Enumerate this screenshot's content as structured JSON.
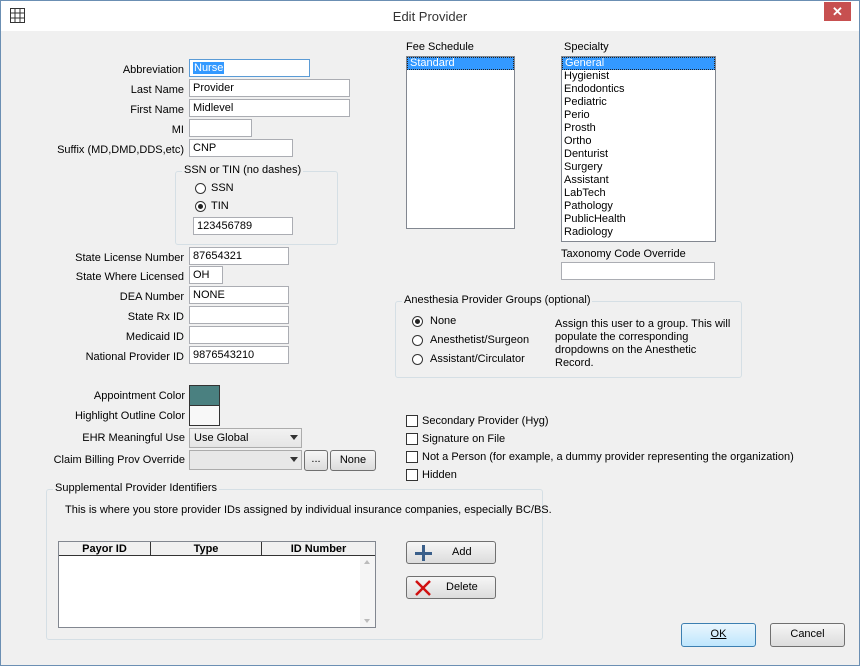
{
  "window": {
    "title": "Edit Provider"
  },
  "fields": {
    "abbreviation": {
      "label": "Abbreviation",
      "value": "Nurse"
    },
    "last_name": {
      "label": "Last Name",
      "value": "Provider"
    },
    "first_name": {
      "label": "First Name",
      "value": "Midlevel"
    },
    "mi": {
      "label": "MI",
      "value": ""
    },
    "suffix": {
      "label": "Suffix (MD,DMD,DDS,etc)",
      "value": "CNP"
    },
    "state_license": {
      "label": "State License Number",
      "value": "87654321"
    },
    "state_where_licensed": {
      "label": "State Where Licensed",
      "value": "OH"
    },
    "dea": {
      "label": "DEA Number",
      "value": "NONE"
    },
    "state_rx": {
      "label": "State Rx ID",
      "value": ""
    },
    "medicaid": {
      "label": "Medicaid ID",
      "value": ""
    },
    "npi": {
      "label": "National Provider ID",
      "value": "9876543210"
    }
  },
  "ssn_tin": {
    "title": "SSN or TIN (no dashes)",
    "ssn_label": "SSN",
    "tin_label": "TIN",
    "selected": "TIN",
    "value": "123456789"
  },
  "fee_schedule": {
    "label": "Fee Schedule",
    "items": [
      "Standard"
    ],
    "selected": "Standard"
  },
  "specialty": {
    "label": "Specialty",
    "items": [
      "General",
      "Hygienist",
      "Endodontics",
      "Pediatric",
      "Perio",
      "Prosth",
      "Ortho",
      "Denturist",
      "Surgery",
      "Assistant",
      "LabTech",
      "Pathology",
      "PublicHealth",
      "Radiology"
    ],
    "selected": "General"
  },
  "taxonomy": {
    "label": "Taxonomy Code Override",
    "value": ""
  },
  "anesthesia": {
    "title": "Anesthesia Provider Groups (optional)",
    "options": [
      "None",
      "Anesthetist/Surgeon",
      "Assistant/Circulator"
    ],
    "selected": "None",
    "help": "Assign this user to a group. This will populate the corresponding dropdowns on the Anesthetic Record."
  },
  "colors": {
    "appointment_label": "Appointment Color",
    "appointment_color": "#4a8080",
    "highlight_label": "Highlight Outline Color",
    "highlight_color": "#f8f8f8"
  },
  "ehr": {
    "label": "EHR Meaningful Use",
    "value": "Use Global"
  },
  "claim_billing": {
    "label": "Claim Billing Prov Override",
    "value": "",
    "browse_label": "...",
    "none_label": "None"
  },
  "checkboxes": [
    {
      "label": "Secondary Provider (Hyg)",
      "checked": false
    },
    {
      "label": "Signature on File",
      "checked": false
    },
    {
      "label": "Not a Person (for example, a dummy provider representing the organization)",
      "checked": false
    },
    {
      "label": "Hidden",
      "checked": false
    }
  ],
  "supplemental": {
    "title": "Supplemental Provider Identifiers",
    "description": "This is where you store provider IDs assigned by individual insurance companies, especially BC/BS.",
    "columns": [
      "Payor ID",
      "Type",
      "ID Number"
    ],
    "rows": [],
    "add_label": "Add",
    "delete_label": "Delete"
  },
  "footer": {
    "ok_label": "OK",
    "cancel_label": "Cancel"
  }
}
